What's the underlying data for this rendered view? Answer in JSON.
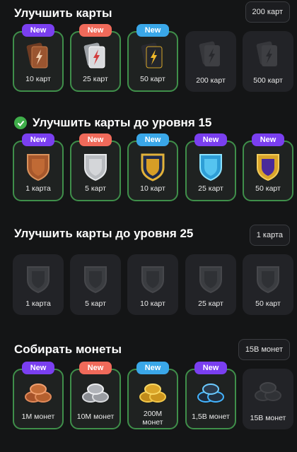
{
  "badge_text": "New",
  "colors": {
    "badge_purple": "#7a3ff0",
    "badge_salmon": "#f06a5a",
    "badge_blue": "#3aa7e8",
    "active_border": "#3f8f4a"
  },
  "sections": [
    {
      "title": "Улучшить карты",
      "pill": "200 карт",
      "cards": [
        {
          "label": "10 карт",
          "icon": "brown-cards-icon"
        },
        {
          "label": "25 карт",
          "icon": "silver-cards-icon"
        },
        {
          "label": "50 карт",
          "icon": "gold-cards-icon"
        },
        {
          "label": "200 карт",
          "icon": "grey-cards-icon"
        },
        {
          "label": "500 карт",
          "icon": "grey-cards-icon"
        }
      ]
    },
    {
      "title": "Улучшить карты до уровня 15",
      "pill": "",
      "cards": [
        {
          "label": "1 карта",
          "icon": "bronze-shield-icon"
        },
        {
          "label": "5 карт",
          "icon": "silver-shield-icon"
        },
        {
          "label": "10 карт",
          "icon": "gold-shield-icon"
        },
        {
          "label": "25 карт",
          "icon": "diamond-shield-icon"
        },
        {
          "label": "50 карт",
          "icon": "purple-gold-shield-icon"
        }
      ]
    },
    {
      "title": "Улучшить карты до уровня 25",
      "pill": "1 карта",
      "cards": [
        {
          "label": "1 карта",
          "icon": "dark-shield-icon"
        },
        {
          "label": "5 карт",
          "icon": "dark-shield-icon"
        },
        {
          "label": "10 карт",
          "icon": "dark-shield-icon"
        },
        {
          "label": "25 карт",
          "icon": "dark-shield-icon"
        },
        {
          "label": "50 карт",
          "icon": "dark-shield-icon"
        }
      ]
    },
    {
      "title": "Собирать монеты",
      "pill": "15B монет",
      "cards": [
        {
          "label": "1M монет",
          "icon": "bronze-coins-icon"
        },
        {
          "label": "10M монет",
          "icon": "silver-coins-icon"
        },
        {
          "label": "200M монет",
          "icon": "gold-coins-icon"
        },
        {
          "label": "1,5B монет",
          "icon": "blue-coins-icon"
        },
        {
          "label": "15B монет",
          "icon": "grey-coins-icon"
        }
      ]
    }
  ]
}
